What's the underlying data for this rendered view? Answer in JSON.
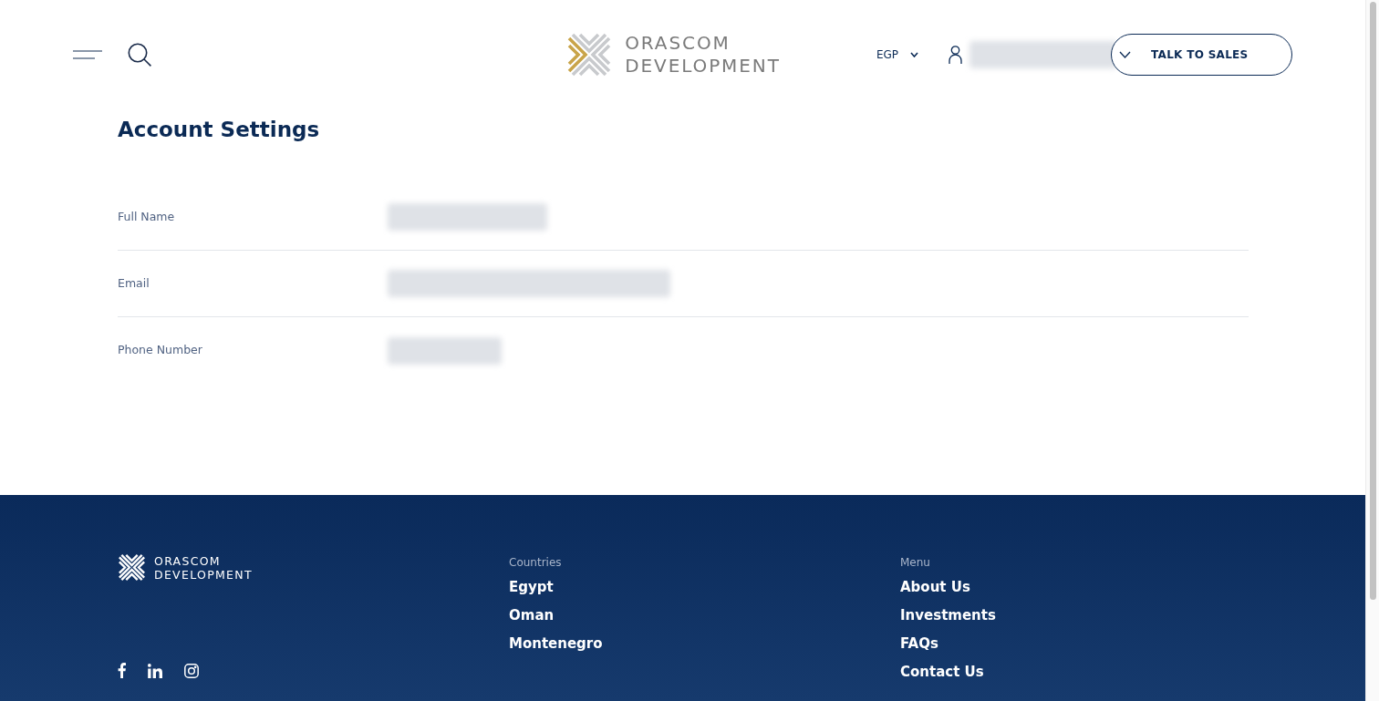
{
  "header": {
    "logo": {
      "wordmark": [
        "ORASCOM",
        "DEVELOPMENT"
      ]
    },
    "currency": "EGP",
    "account": {
      "redacted": true
    },
    "cta_button": "TALK TO SALES"
  },
  "page": {
    "title": "Account Settings",
    "fields": [
      {
        "label": "Full Name",
        "redacted": true
      },
      {
        "label": "Email",
        "redacted": true
      },
      {
        "label": "Phone Number",
        "redacted": true
      }
    ]
  },
  "footer": {
    "logo": {
      "wordmark": [
        "ORASCOM",
        "DEVELOPMENT"
      ]
    },
    "columns": [
      {
        "heading": "Countries",
        "links": [
          "Egypt",
          "Oman",
          "Montenegro"
        ]
      },
      {
        "heading": "Menu",
        "links": [
          "About Us",
          "Investments",
          "FAQs",
          "Contact Us"
        ]
      }
    ]
  }
}
